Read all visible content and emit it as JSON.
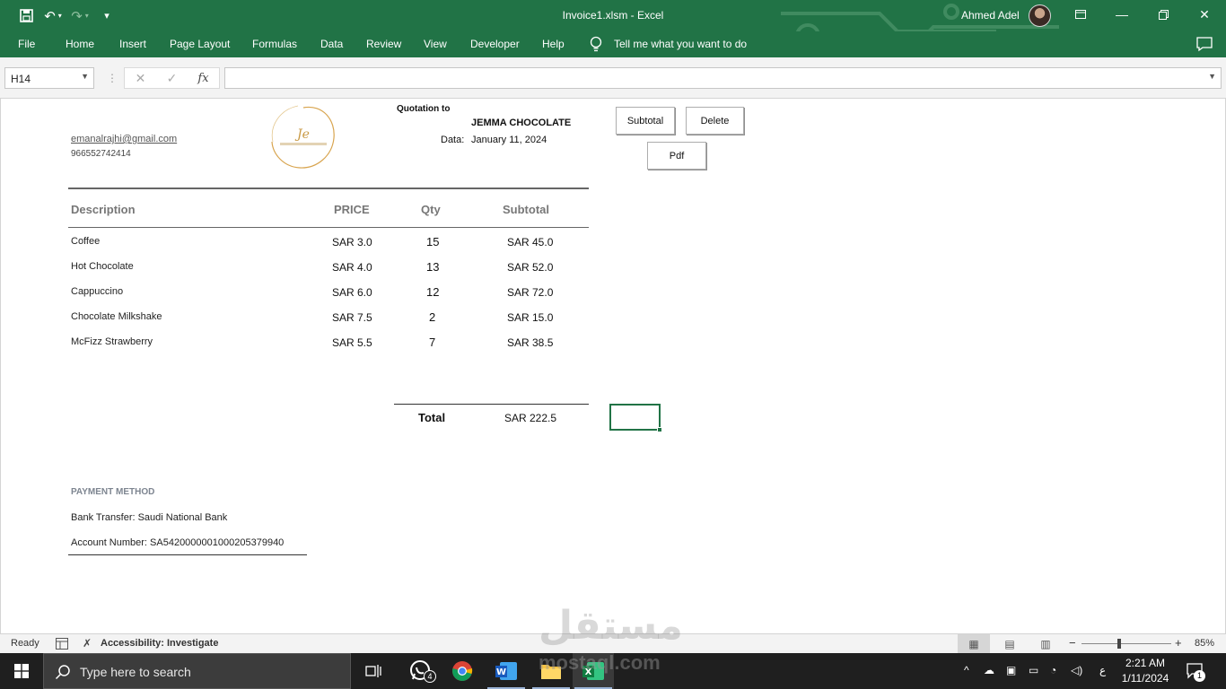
{
  "window": {
    "title": "Invoice1.xlsm  -  Excel",
    "user_name": "Ahmed Adel"
  },
  "ribbon": {
    "tabs": [
      "File",
      "Home",
      "Insert",
      "Page Layout",
      "Formulas",
      "Data",
      "Review",
      "View",
      "Developer",
      "Help"
    ],
    "tell_me": "Tell me what you want to do"
  },
  "formula_bar": {
    "name_box": "H14",
    "formula": "",
    "fx_label": "fx"
  },
  "invoice": {
    "email": "emanalrajhi@gmail.com",
    "phone": "966552742414",
    "quotation_label": "Quotation to",
    "client_name": "JEMMA CHOCOLATE",
    "date_label": "Data:",
    "date_value": "January 11, 2024",
    "columns": [
      "Description",
      "PRICE",
      "Qty",
      "Subtotal"
    ],
    "items": [
      {
        "description": "Coffee",
        "price": "SAR 3.0",
        "qty": "15",
        "subtotal": "SAR 45.0"
      },
      {
        "description": "Hot Chocolate",
        "price": "SAR 4.0",
        "qty": "13",
        "subtotal": "SAR 52.0"
      },
      {
        "description": "Cappuccino",
        "price": "SAR 6.0",
        "qty": "12",
        "subtotal": "SAR 72.0"
      },
      {
        "description": "Chocolate Milkshake",
        "price": "SAR 7.5",
        "qty": "2",
        "subtotal": "SAR 15.0"
      },
      {
        "description": "McFizz Strawberry",
        "price": "SAR 5.5",
        "qty": "7",
        "subtotal": "SAR 38.5"
      }
    ],
    "total_label": "Total",
    "total_value": "SAR 222.5",
    "payment_heading": "PAYMENT METHOD",
    "payment_line1": "Bank Transfer: Saudi National Bank",
    "payment_line2": "Account Number: SA5420000001000205379940"
  },
  "sheet_buttons": {
    "subtotal": "Subtotal",
    "delete": "Delete",
    "pdf": "Pdf"
  },
  "status_bar": {
    "ready": "Ready",
    "accessibility": "Accessibility: Investigate",
    "zoom": "85%"
  },
  "taskbar": {
    "search_placeholder": "Type here to search",
    "whatsapp_badge": "4",
    "input_lang": "ع",
    "time": "2:21 AM",
    "date": "1/11/2024",
    "notification_count": "1"
  },
  "watermark": {
    "logo_text": "مستقل",
    "site": "mostaql.com"
  },
  "colors": {
    "excel_green": "#217346",
    "taskbar": "#1f1f1f",
    "logo_gold": "#d8a44e"
  }
}
